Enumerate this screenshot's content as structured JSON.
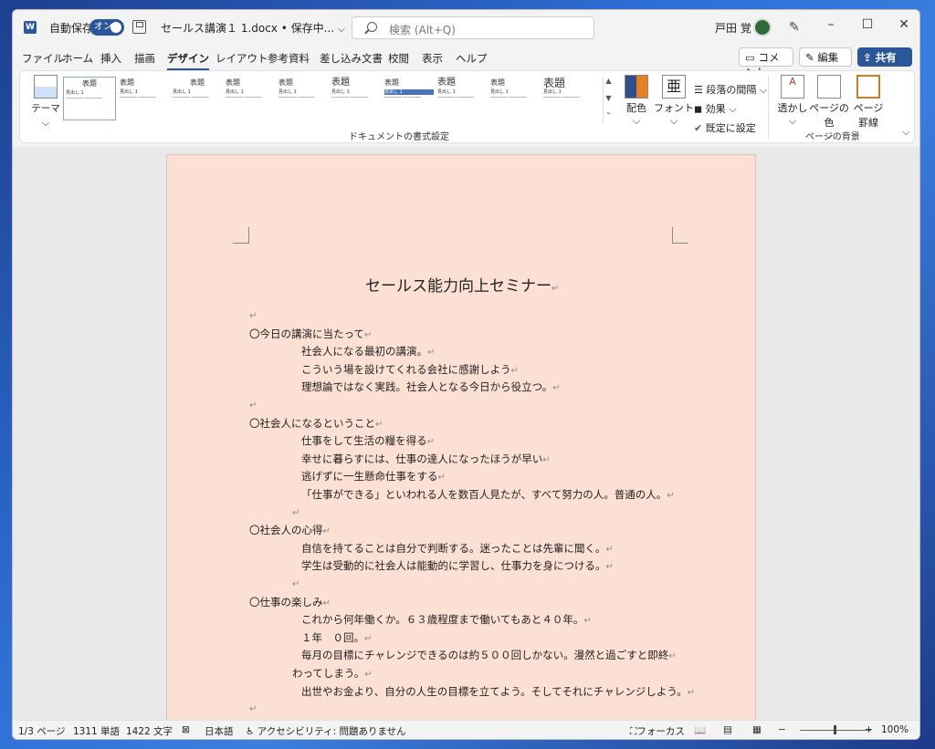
{
  "titlebar": {
    "autosave_label": "自動保存",
    "autosave_state": "オン",
    "doc_title": "セールス講演１ 1.docx • 保存中...",
    "search_placeholder": "検索 (Alt+Q)",
    "user_name": "戸田 覚"
  },
  "tabs": [
    "ファイル",
    "ホーム",
    "挿入",
    "描画",
    "デザイン",
    "レイアウト",
    "参考資料",
    "差し込み文書",
    "校閲",
    "表示",
    "ヘルプ"
  ],
  "active_tab": "デザイン",
  "actions": {
    "comment": "コメント",
    "edit": "編集",
    "share": "共有"
  },
  "ribbon": {
    "theme_label": "テーマ",
    "styles": [
      {
        "heading": "表題",
        "sub": "見出し 1"
      },
      {
        "heading": "表題",
        "sub": "見出し 1"
      },
      {
        "heading": "表題",
        "sub": "見出し 1"
      },
      {
        "heading": "表題",
        "sub": "見出し 1"
      },
      {
        "heading": "表題",
        "sub": "見出し 1"
      },
      {
        "heading": "表題",
        "sub": "見出し 1"
      },
      {
        "heading": "表題",
        "sub": "見出し 1"
      },
      {
        "heading": "表題",
        "sub": "見出し 1"
      },
      {
        "heading": "表題",
        "sub": "見出し 1"
      },
      {
        "heading": "表題",
        "sub": "見出し 1"
      }
    ],
    "doc_format_group": "ドキュメントの書式設定",
    "colors": "配色",
    "fonts": "フォント",
    "paragraph_spacing": "段落の間隔",
    "effects": "効果",
    "set_default": "既定に設定",
    "watermark": "透かし",
    "page_color": "ページの色",
    "page_borders_1": "ページ",
    "page_borders_2": "罫線",
    "page_bg_group": "ページの背景"
  },
  "document": {
    "title": "セールス能力向上セミナー",
    "lines": [
      {
        "indent": 0,
        "text": ""
      },
      {
        "indent": 0,
        "text": "〇今日の講演に当たって"
      },
      {
        "indent": 1,
        "text": "社会人になる最初の講演。"
      },
      {
        "indent": 1,
        "text": "こういう場を設けてくれる会社に感謝しよう"
      },
      {
        "indent": 1,
        "text": "理想論ではなく実践。社会人となる今日から役立つ。"
      },
      {
        "indent": 0,
        "text": ""
      },
      {
        "indent": 0,
        "text": "〇社会人になるということ"
      },
      {
        "indent": 1,
        "text": "仕事をして生活の糧を得る"
      },
      {
        "indent": 1,
        "text": "幸せに暮らすには、仕事の達人になったほうが早い"
      },
      {
        "indent": 1,
        "text": "逃げずに一生懸命仕事をする"
      },
      {
        "indent": 1,
        "text": "「仕事ができる」といわれる人を数百人見たが、すべて努力の人。普通の人。"
      },
      {
        "indent": 2,
        "text": ""
      },
      {
        "indent": 0,
        "text": "〇社会人の心得"
      },
      {
        "indent": 1,
        "text": "自信を持てることは自分で判断する。迷ったことは先輩に聞く。"
      },
      {
        "indent": 1,
        "text": "学生は受動的に社会人は能動的に学習し、仕事力を身につける。"
      },
      {
        "indent": 2,
        "text": ""
      },
      {
        "indent": 0,
        "text": "〇仕事の楽しみ"
      },
      {
        "indent": 1,
        "text": "これから何年働くか。６３歳程度まで働いてもあと４０年。"
      },
      {
        "indent": 1,
        "text": "１年　０回。"
      },
      {
        "indent": 1,
        "text": "毎月の目標にチャレンジできるのは約５００回しかない。漫然と過ごすと即終"
      },
      {
        "indent": 2,
        "text": "わってしまう。"
      },
      {
        "indent": 1,
        "text": "出世やお金より、自分の人生の目標を立てよう。そしてそれにチャレンジしよう。"
      },
      {
        "indent": 0,
        "text": ""
      }
    ]
  },
  "status": {
    "page": "1/3 ページ",
    "words": "1311 単語",
    "chars": "1422 文字",
    "language": "日本語",
    "accessibility": "アクセシビリティ: 問題ありません",
    "focus": "フォーカス",
    "zoom": "100%",
    "zoom_level": 1.0
  }
}
